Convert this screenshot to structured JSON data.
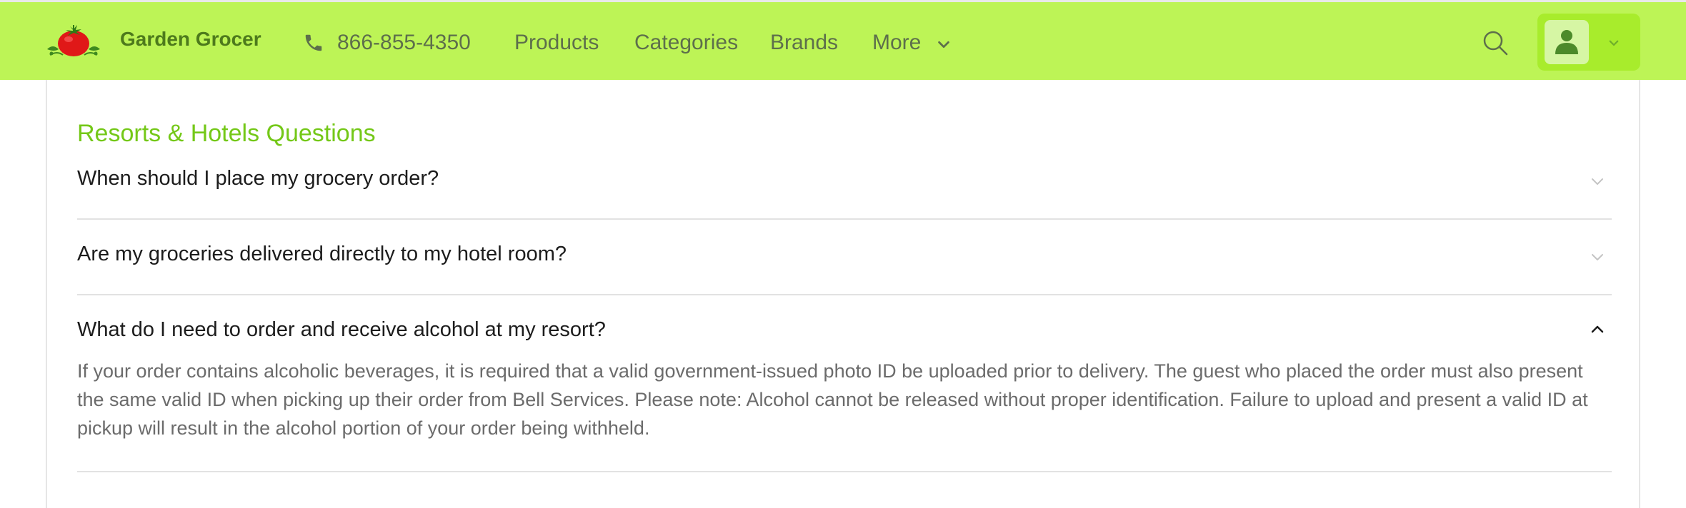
{
  "header": {
    "brand": "Garden Grocer",
    "phone": "866-855-4350",
    "nav": {
      "products": "Products",
      "categories": "Categories",
      "brands": "Brands",
      "more": "More"
    },
    "icons": {
      "logo": "tomato-logo-icon",
      "phone": "phone-icon",
      "more": "chevron-down-icon",
      "search": "search-icon",
      "account": "user-icon",
      "account_menu": "chevron-down-icon"
    },
    "colors": {
      "bar": "#bdf456",
      "brand_text": "#4d7a1c",
      "account_button": "#a8ec2c"
    }
  },
  "faq": {
    "section_title": "Resorts & Hotels Questions",
    "title_color": "#74c818",
    "items": [
      {
        "question": "When should I place my grocery order?",
        "expanded": false
      },
      {
        "question": "Are my groceries delivered directly to my hotel room?",
        "expanded": false
      },
      {
        "question": "What do I need to order and receive alcohol at my resort?",
        "expanded": true,
        "answer": "If your order contains alcoholic beverages, it is required that a valid government-issued photo ID be uploaded prior to delivery. The guest who placed the order must also present the same valid ID when picking up their order from Bell Services. Please note: Alcohol cannot be released without proper identification. Failure to upload and present a valid ID at pickup will result in the alcohol portion of your order being withheld."
      }
    ]
  }
}
